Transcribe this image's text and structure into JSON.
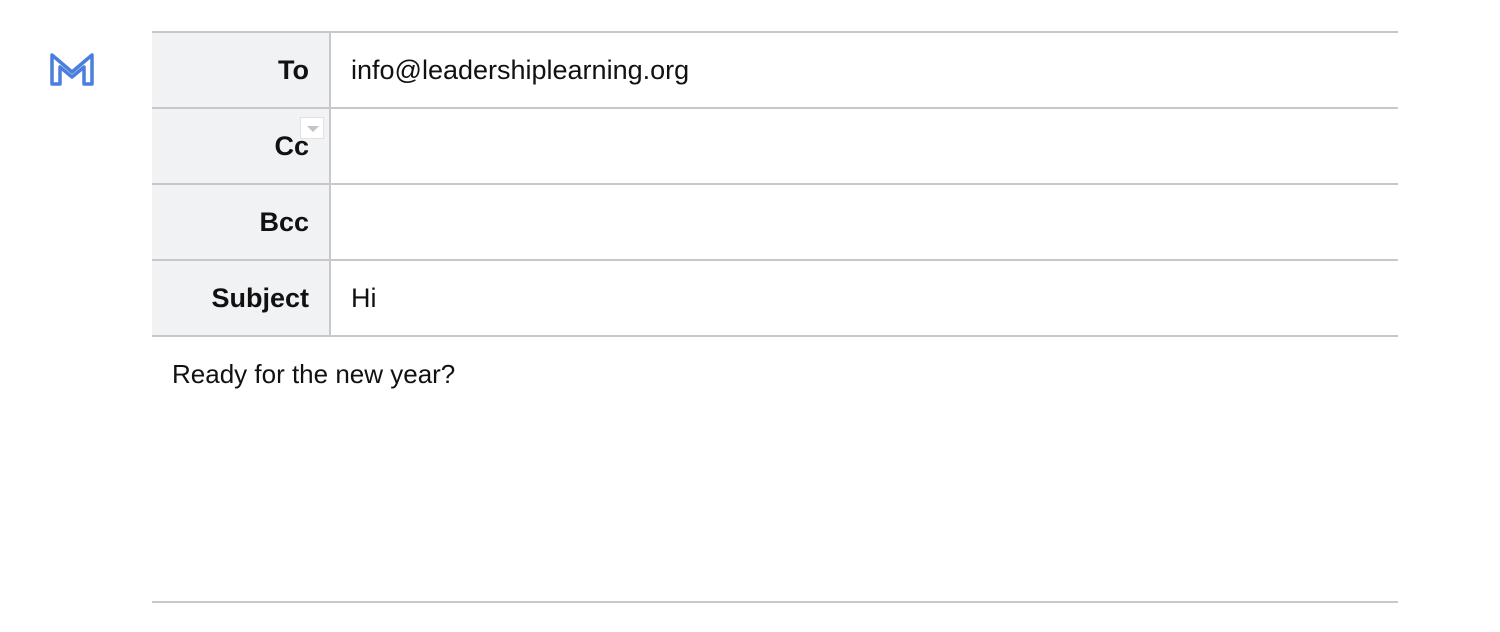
{
  "app": {
    "icon": "gmail-m-icon",
    "accent_color": "#4a7fdc"
  },
  "compose": {
    "to_label": "To",
    "to_value": "info@leadershiplearning.org",
    "cc_label": "Cc",
    "cc_value": "",
    "bcc_label": "Bcc",
    "bcc_value": "",
    "subject_label": "Subject",
    "subject_value": "Hi",
    "body": "Ready for the new year?"
  }
}
